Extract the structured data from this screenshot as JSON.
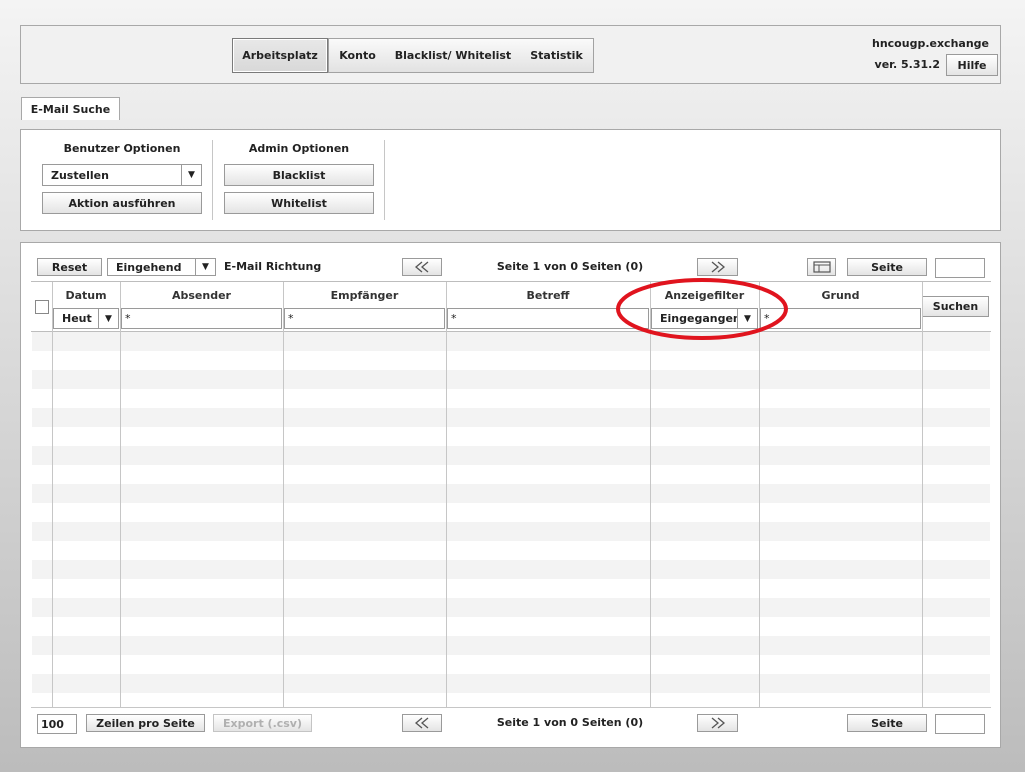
{
  "header": {
    "nav": [
      "Arbeitsplatz",
      "Konto",
      "Blacklist/ Whitelist",
      "Statistik"
    ],
    "hostname": "hncougp.exchange",
    "version": "ver. 5.31.2",
    "help_label": "Hilfe"
  },
  "tab": {
    "label": "E-Mail Suche"
  },
  "options": {
    "user_title": "Benutzer Optionen",
    "user_select": "Zustellen",
    "execute_label": "Aktion ausführen",
    "admin_title": "Admin Optionen",
    "blacklist_label": "Blacklist",
    "whitelist_label": "Whitelist"
  },
  "toolbar": {
    "reset_label": "Reset",
    "direction_select": "Eingehend",
    "direction_label": "E-Mail Richtung",
    "first_icon": "rewind-icon",
    "next_icon": "fast-forward-icon",
    "page_info": "Seite 1 von 0 Seiten (0)",
    "page_label": "Seite",
    "page_input": ""
  },
  "table": {
    "columns": [
      "Datum",
      "Absender",
      "Empfänger",
      "Betreff",
      "Anzeigefilter",
      "Grund"
    ],
    "filters": {
      "date_select": "Heut",
      "sender": "*",
      "recipient": "*",
      "subject": "*",
      "display_select": "Eingegangen",
      "reason": "*"
    },
    "search_label": "Suchen",
    "rows": []
  },
  "footer": {
    "rows_per_page_value": "100",
    "rows_per_page_label": "Zeilen pro Seite",
    "export_label": "Export (.csv)",
    "page_info": "Seite 1 von 0 Seiten (0)",
    "page_label": "Seite",
    "page_input": ""
  },
  "colors": {
    "highlight_circle": "#e0141e"
  }
}
